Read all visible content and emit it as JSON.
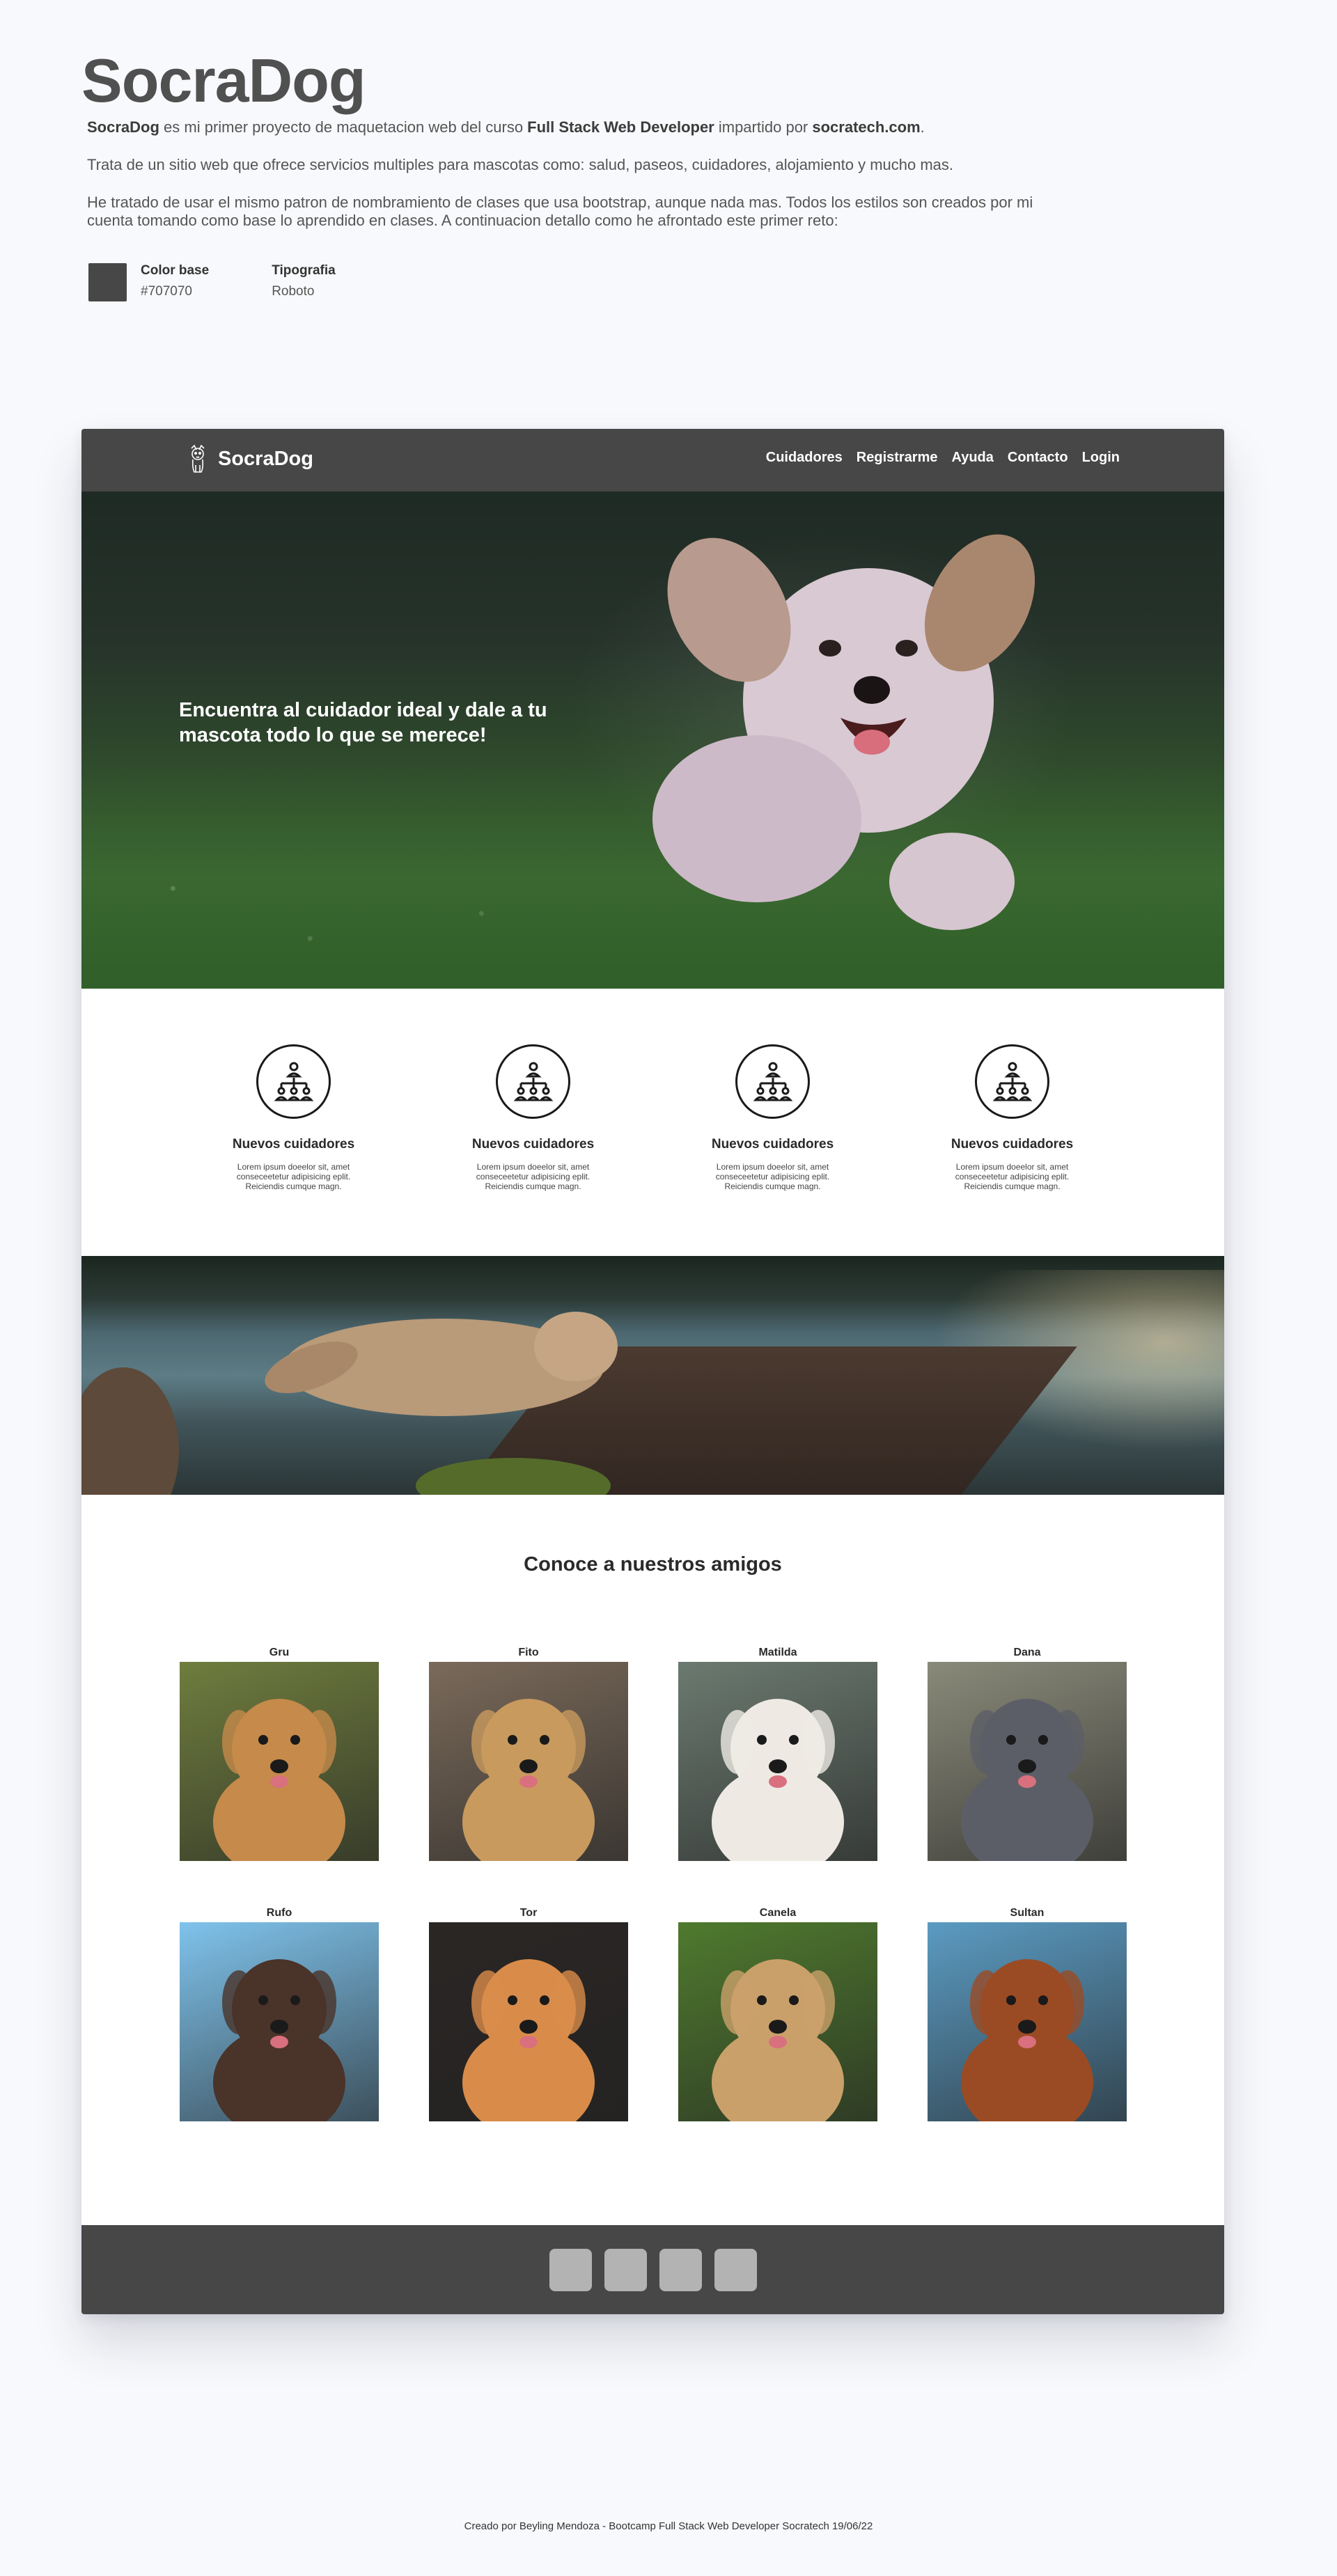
{
  "intro": {
    "title": "SocraDog",
    "p1": {
      "a": "SocraDog",
      "b": " es mi primer proyecto de maquetacion web del curso ",
      "c": "Full Stack Web Developer",
      "d": " impartido por ",
      "e": "socratech.com",
      "f": "."
    },
    "p2": "Trata de un sitio web que ofrece servicios multiples para mascotas como: salud, paseos, cuidadores, alojamiento y mucho mas.",
    "p3": "He tratado de usar el mismo patron de nombramiento de clases que usa bootstrap, aunque nada mas. Todos los estilos son creados por mi cuenta tomando como base lo aprendido en clases. A continuacion detallo como he afrontado este primer reto:",
    "spec_color_label": "Color base",
    "spec_color_value": "#707070",
    "spec_font_label": "Tipografia",
    "spec_font_value": "Roboto",
    "swatch_color": "#474747"
  },
  "mockup": {
    "brand": "SocraDog",
    "nav": [
      "Cuidadores",
      "Registrarme",
      "Ayuda",
      "Contacto",
      "Login"
    ],
    "hero_text": "Encuentra al cuidador ideal y dale a tu mascota todo lo que se merece!",
    "features": [
      {
        "title": "Nuevos cuidadores",
        "text": "Lorem ipsum doeelor sit, amet conseceetetur adipisicing eplit. Reiciendis cumque magn."
      },
      {
        "title": "Nuevos cuidadores",
        "text": "Lorem ipsum doeelor sit, amet conseceetetur adipisicing eplit. Reiciendis cumque magn."
      },
      {
        "title": "Nuevos cuidadores",
        "text": "Lorem ipsum doeelor sit, amet conseceetetur adipisicing eplit. Reiciendis cumque magn."
      },
      {
        "title": "Nuevos cuidadores",
        "text": "Lorem ipsum doeelor sit, amet conseceetetur adipisicing eplit. Reiciendis cumque magn."
      }
    ],
    "friends_title": "Conoce a nuestros amigos",
    "friends": [
      {
        "name": "Gru",
        "bg": "#6f7d3e",
        "coat": "#c68a4b"
      },
      {
        "name": "Fito",
        "bg": "#7a6a5a",
        "coat": "#c99a5e"
      },
      {
        "name": "Matilda",
        "bg": "#6b7a70",
        "coat": "#eeeae3"
      },
      {
        "name": "Dana",
        "bg": "#8a8a7a",
        "coat": "#5b5e66"
      },
      {
        "name": "Rufo",
        "bg": "#7fc3ec",
        "coat": "#4a3329"
      },
      {
        "name": "Tor",
        "bg": "#2a2624",
        "coat": "#d98c4a"
      },
      {
        "name": "Canela",
        "bg": "#4f7a2e",
        "coat": "#caa06a"
      },
      {
        "name": "Sultan",
        "bg": "#5b9bc2",
        "coat": "#9a4b24"
      }
    ],
    "social_count": 4
  },
  "footer_credit": "Creado por Beyling Mendoza - Bootcamp Full Stack Web Developer Socratech 19/06/22"
}
